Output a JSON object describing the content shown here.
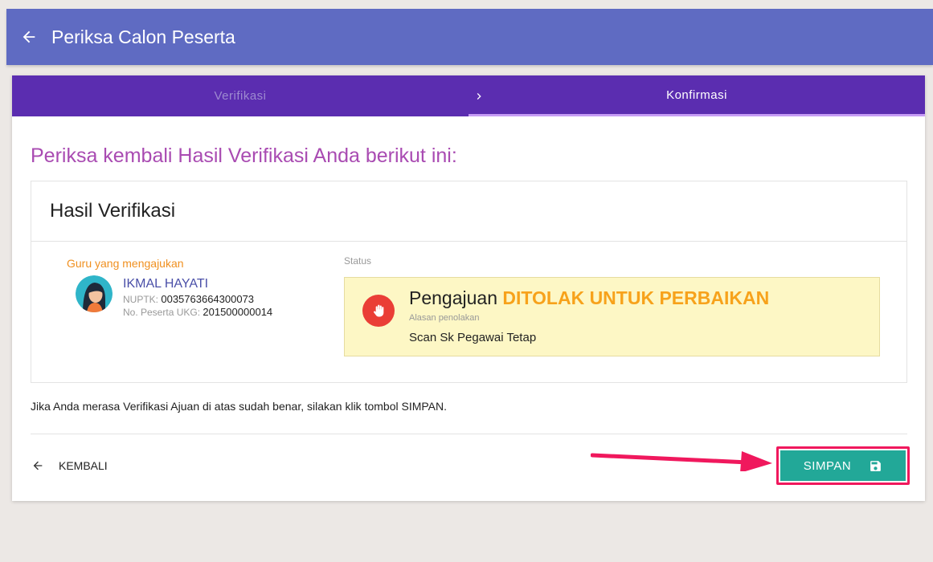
{
  "appbar": {
    "title": "Periksa Calon Peserta"
  },
  "stepper": {
    "steps": [
      {
        "label": "Verifikasi"
      },
      {
        "label": "Konfirmasi"
      }
    ]
  },
  "page": {
    "heading": "Periksa kembali Hasil Verifikasi Anda berikut ini:"
  },
  "result": {
    "title": "Hasil Verifikasi",
    "guru_label": "Guru yang mengajukan",
    "name": "IKMAL HAYATI",
    "nuptk_label": "NUPTK:",
    "nuptk": "0035763664300073",
    "ukg_label": "No. Peserta UKG:",
    "ukg": "201500000014",
    "status_label": "Status",
    "status_prefix": "Pengajuan",
    "status_highlight": "DITOLAK UNTUK PERBAIKAN",
    "reason_label": "Alasan penolakan",
    "reason": "Scan Sk Pegawai Tetap"
  },
  "footer": {
    "hint": "Jika Anda merasa Verifikasi Ajuan di atas sudah benar, silakan klik tombol SIMPAN.",
    "back_label": "KEMBALI",
    "save_label": "SIMPAN"
  },
  "colors": {
    "appbar": "#5f6bc2",
    "stepper": "#5b2db0",
    "heading": "#a94bb2",
    "status_highlight": "#f7a21b",
    "status_bg": "#fdf7c5",
    "save_button": "#22a898",
    "annotation": "#f0185d"
  },
  "icons": {
    "back": "arrow-left-icon",
    "step_separator": "chevron-right-icon",
    "stop": "hand-stop-icon",
    "save": "floppy-disk-icon"
  }
}
